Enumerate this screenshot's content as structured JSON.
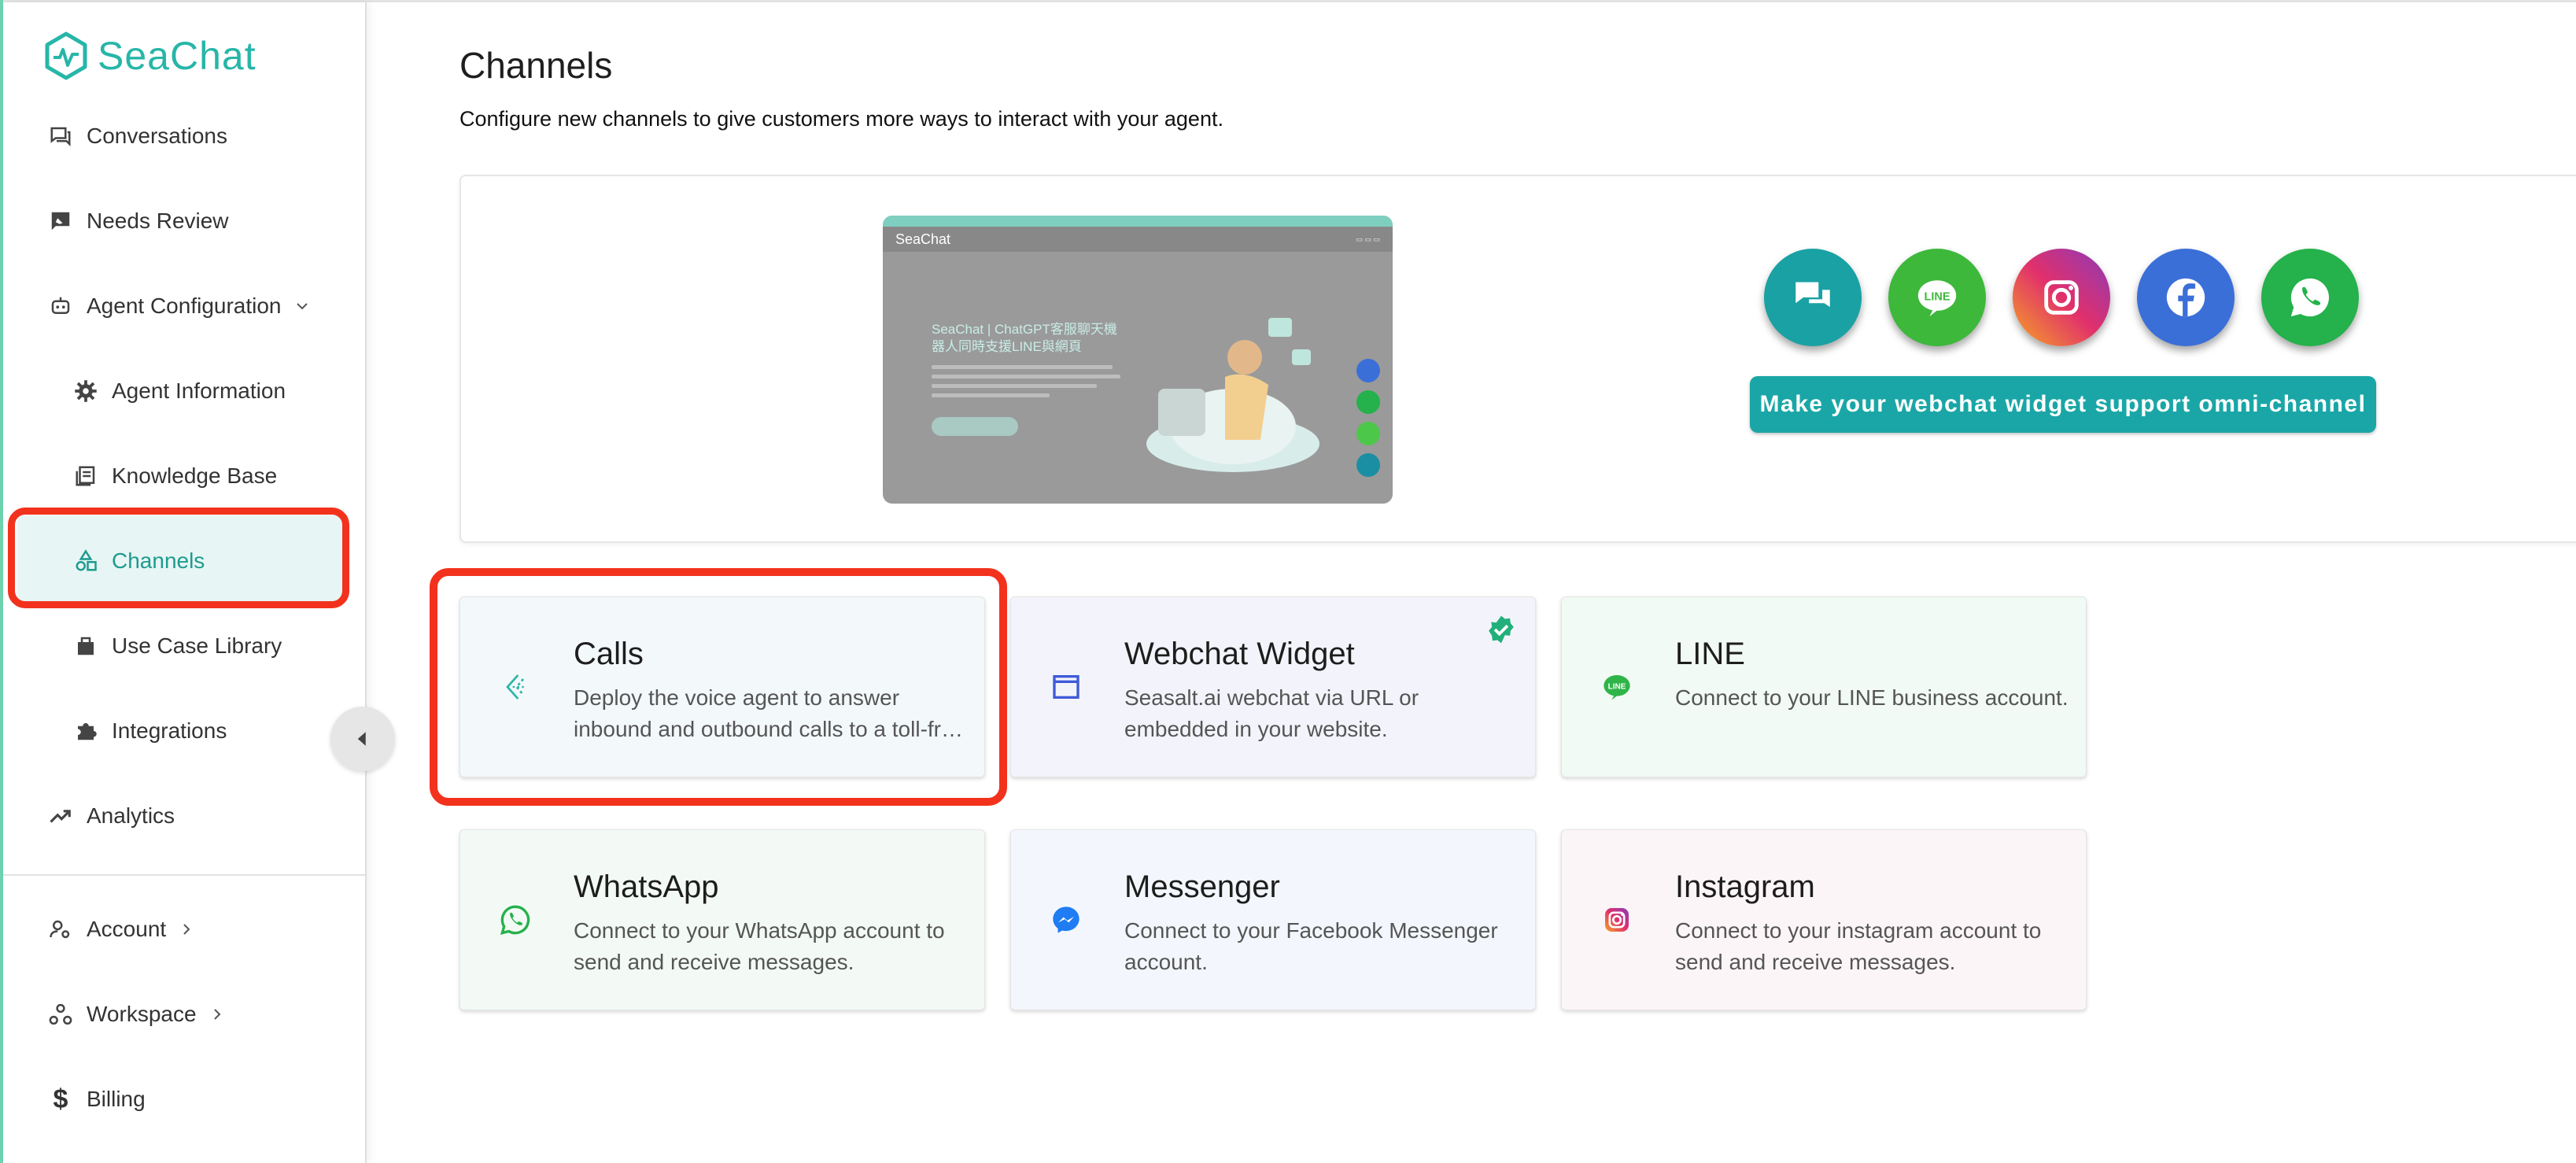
{
  "app": {
    "brand": "SeaChat",
    "accent": "#27b6a8",
    "highlight": "#f3321d"
  },
  "sidebar": {
    "items": [
      {
        "label": "Conversations",
        "icon": "chat-icon"
      },
      {
        "label": "Needs Review",
        "icon": "review-icon"
      },
      {
        "label": "Agent Configuration",
        "icon": "robot-icon",
        "expanded": true
      },
      {
        "label": "Agent Information",
        "icon": "gear-icon"
      },
      {
        "label": "Knowledge Base",
        "icon": "book-icon"
      },
      {
        "label": "Channels",
        "icon": "shapes-icon",
        "active": true
      },
      {
        "label": "Use Case Library",
        "icon": "library-icon"
      },
      {
        "label": "Integrations",
        "icon": "puzzle-icon"
      },
      {
        "label": "Analytics",
        "icon": "trend-icon"
      },
      {
        "label": "Account",
        "icon": "account-icon"
      },
      {
        "label": "Workspace",
        "icon": "workspace-icon"
      },
      {
        "label": "Billing",
        "icon": "dollar-icon"
      }
    ]
  },
  "main": {
    "title": "Channels",
    "subtitle": "Configure new channels to give customers more ways to interact with your agent.",
    "banner": {
      "preview_brand": "SeaChat",
      "preview_headline": "SeaChat | ChatGPT客服聊天機器人同時支援LINE與網頁",
      "cta": "Make your webchat widget support omni-channel",
      "channel_icons": [
        "chat-icon",
        "line-icon",
        "instagram-icon",
        "facebook-icon",
        "whatsapp-icon"
      ]
    },
    "cards": [
      {
        "title": "Calls",
        "desc": "Deploy the voice agent to answer inbound and outbound calls to a toll-free number.",
        "icon": "calls-icon"
      },
      {
        "title": "Webchat Widget",
        "desc": "Seasalt.ai webchat via URL or embedded in your website.",
        "icon": "browser-window-icon",
        "enabled": true
      },
      {
        "title": "LINE",
        "desc": "Connect to your LINE business account.",
        "icon": "line-icon"
      },
      {
        "title": "WhatsApp",
        "desc": "Connect to your WhatsApp account to send and receive messages.",
        "icon": "whatsapp-icon"
      },
      {
        "title": "Messenger",
        "desc": "Connect to your Facebook Messenger account.",
        "icon": "messenger-icon"
      },
      {
        "title": "Instagram",
        "desc": "Connect to your instagram account to send and receive messages.",
        "icon": "instagram-icon"
      }
    ]
  }
}
